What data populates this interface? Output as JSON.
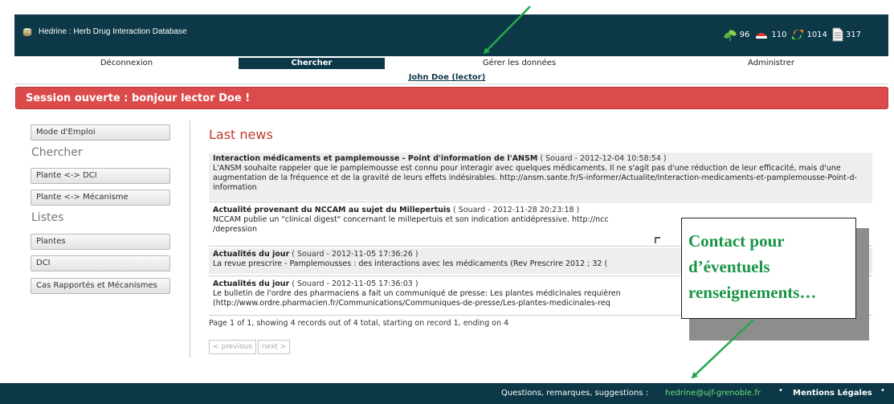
{
  "header": {
    "title": "Hedrine : Herb Drug Interaction Database",
    "stats": [
      {
        "icon": "plant-icon",
        "value": "96"
      },
      {
        "icon": "pill-icon",
        "value": "110"
      },
      {
        "icon": "interaction-arrows-icon",
        "value": "1014"
      },
      {
        "icon": "document-icon",
        "value": "317"
      }
    ]
  },
  "nav": {
    "logout": "Déconnexion",
    "search": "Chercher",
    "manage": "Gérer les données",
    "admin": "Administrer"
  },
  "user": "John Doe (lector)",
  "banner": "Session ouverte : bonjour lector Doe !",
  "sidebar": {
    "manual": "Mode d'Emploi",
    "search_heading": "Chercher",
    "plant_dci": "Plante <-> DCI",
    "plant_mechanism": "Plante <-> Mécanisme",
    "lists_heading": "Listes",
    "plants": "Plantes",
    "dci": "DCI",
    "cases": "Cas Rapportés et Mécanismes"
  },
  "main": {
    "title": "Last news",
    "news": [
      {
        "title": "Interaction médicaments et pamplemousse - Point d'information de l'ANSM",
        "meta": "( Souard - 2012-12-04 10:58:54 )",
        "body": "L'ANSM souhaite rappeler que le pamplemousse est connu pour interagir avec quelques médicaments. Il ne s'agit pas d'une réduction de leur efficacité, mais d'une augmentation de la fréquence et de la gravité de leurs effets indésirables. http://ansm.sante.fr/S-informer/Actualite/Interaction-medicaments-et-pamplemousse-Point-d-information"
      },
      {
        "title": "Actualité provenant du NCCAM au sujet du Millepertuis",
        "meta": "( Souard - 2012-11-28 20:23:18 )",
        "body": "NCCAM publie un \"clinical digest\" concernant le millepertuis et son indication antidépressive. http://ncc",
        "body2": "/depression"
      },
      {
        "title": "Actualités du jour",
        "meta": "( Souard - 2012-11-05 17:36:26 )",
        "body": "La revue prescrire - Pamplemousses : des interactions avec les médicaments (Rev Prescrire 2012 ; 32 ("
      },
      {
        "title": "Actualités du jour",
        "meta": "( Souard - 2012-11-05 17:36:03 )",
        "body": "Le bulletin de l'ordre des pharmaciens a fait un communiqué de presse: Les plantes médicinales requièren",
        "body2": "(http://www.ordre.pharmacien.fr/Communications/Communiques-de-presse/Les-plantes-medicinales-req"
      }
    ],
    "page_info": "Page 1 of 1, showing 4 records out of 4 total, starting on record 1, ending on 4",
    "prev": "< previous",
    "next": "next >"
  },
  "callout": {
    "line1": "Contact pour",
    "line2": "d’éventuels",
    "line3": "renseignements…"
  },
  "footer": {
    "questions": "Questions, remarques, suggestions :",
    "email": "hedrine@ujf-grenoble.fr",
    "legal": "Mentions Légales",
    "bullet": "•"
  },
  "colors": {
    "header_bg": "#0c3847",
    "banner_bg": "#dc4b4b",
    "news_title": "#c03a2b",
    "callout_text": "#1a9446",
    "arrow": "#22a84a"
  }
}
